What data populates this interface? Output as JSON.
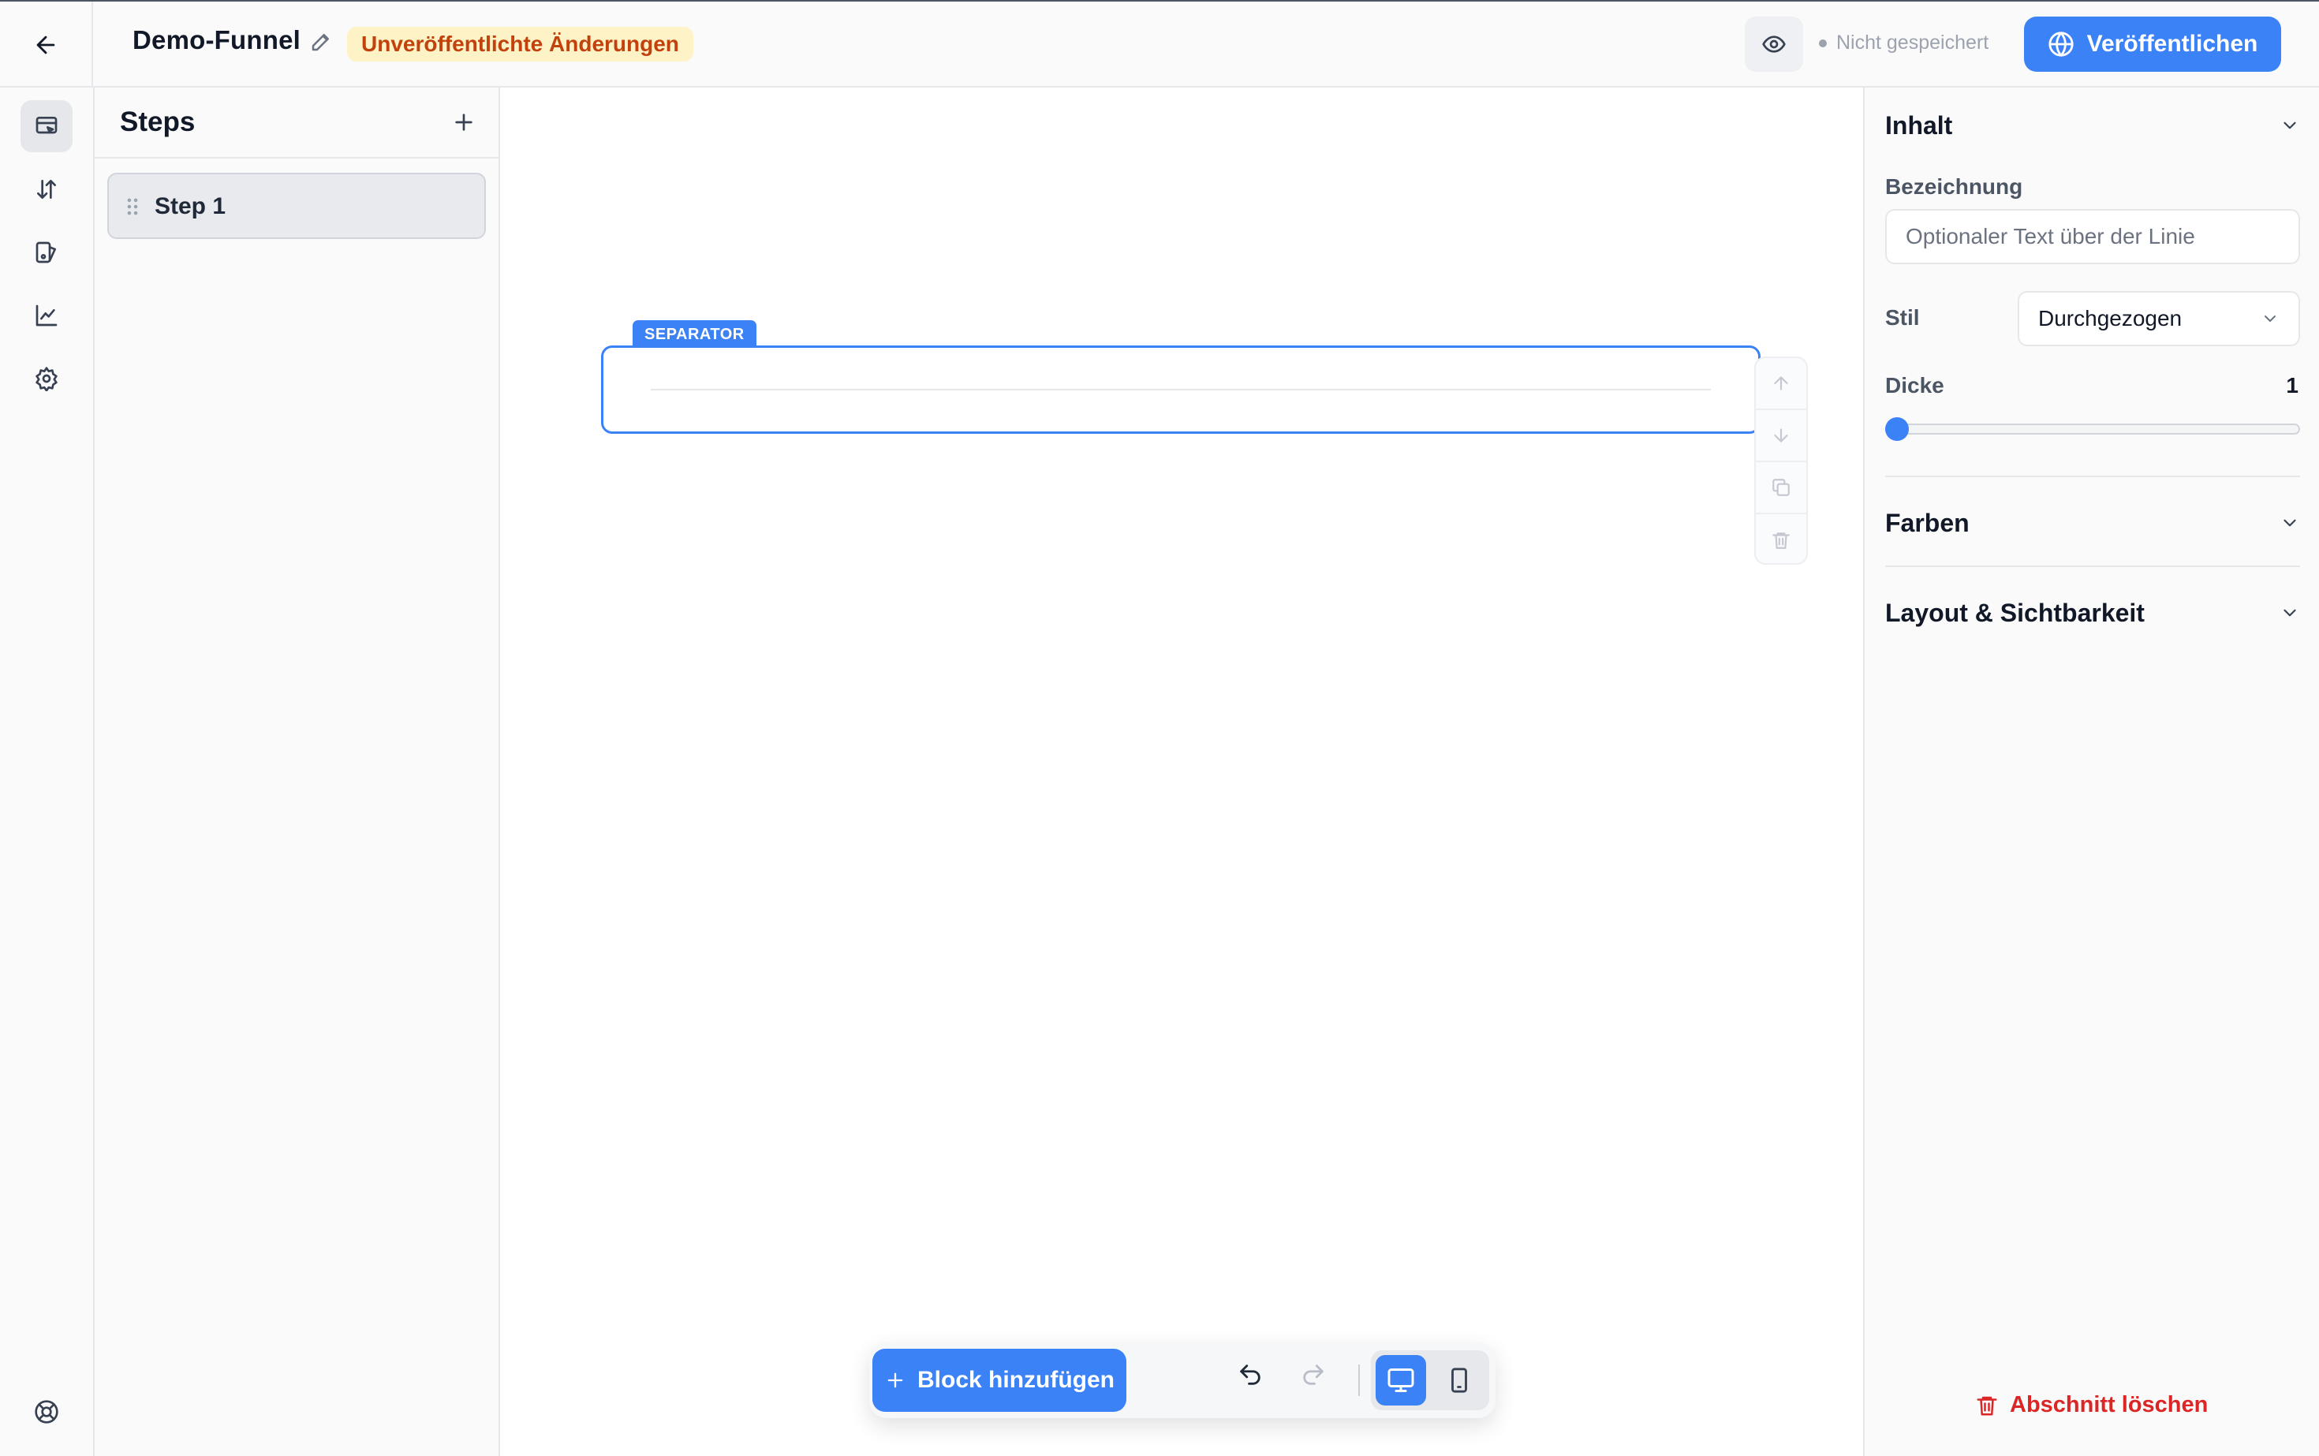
{
  "header": {
    "funnel_name": "Demo-Funnel",
    "unpublished_badge": "Unveröffentlichte Änderungen",
    "save_status": "Nicht gespeichert",
    "publish_label": "Veröffentlichen"
  },
  "rail": {
    "items": [
      {
        "icon": "editor-icon",
        "active": true
      },
      {
        "icon": "sort-arrows-icon",
        "active": false
      },
      {
        "icon": "design-icon",
        "active": false
      },
      {
        "icon": "analytics-icon",
        "active": false
      },
      {
        "icon": "settings-icon",
        "active": false
      }
    ],
    "bottom_icon": "help-lifebuoy-icon"
  },
  "steps_panel": {
    "title": "Steps",
    "items": [
      {
        "label": "Step 1",
        "selected": true
      }
    ]
  },
  "canvas": {
    "block_tag": "SEPARATOR",
    "block_tools": [
      "arrow-up-icon",
      "arrow-down-icon",
      "duplicate-icon",
      "trash-icon"
    ]
  },
  "bottom_toolbar": {
    "add_block_label": "Block hinzufügen",
    "active_view": "desktop"
  },
  "properties": {
    "content_section": {
      "title": "Inhalt",
      "label_field": {
        "label": "Bezeichnung",
        "value": "",
        "placeholder": "Optionaler Text über der Linie"
      },
      "style_field": {
        "label": "Stil",
        "value": "Durchgezogen"
      },
      "thickness_field": {
        "label": "Dicke",
        "value": "1",
        "fraction": 0
      }
    },
    "colors_section": {
      "title": "Farben"
    },
    "layout_section": {
      "title": "Layout & Sichtbarkeit"
    },
    "delete_label": "Abschnitt löschen"
  },
  "colors": {
    "accent": "#3b82f6",
    "badge_bg": "#fef3c7",
    "badge_text": "#c2410c",
    "danger": "#dc2626"
  }
}
